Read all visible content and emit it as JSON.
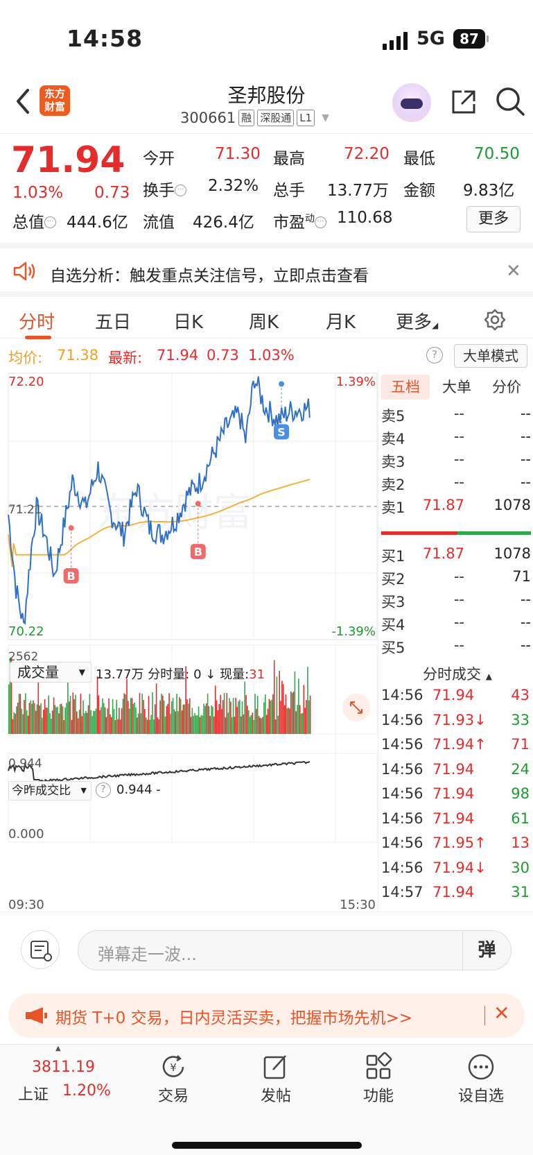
{
  "status_bar": {
    "time": "14:58",
    "network": "5G",
    "battery": "87"
  },
  "header": {
    "logo": "东方财富",
    "stock_name": "圣邦股份",
    "code": "300661",
    "tags": [
      "融",
      "深股通",
      "L1"
    ]
  },
  "quote": {
    "price": "71.94",
    "change_pct": "1.03%",
    "change": "0.73",
    "fields": [
      {
        "label": "今开",
        "value": "71.30",
        "color": "#e32d2d"
      },
      {
        "label": "最高",
        "value": "72.20",
        "color": "#e32d2d"
      },
      {
        "label": "最低",
        "value": "70.50",
        "color": "#1f9a33"
      },
      {
        "label": "换手",
        "value": "2.32%",
        "color": "#222"
      },
      {
        "label": "总手",
        "value": "13.77万",
        "color": "#222"
      },
      {
        "label": "金额",
        "value": "9.83亿",
        "color": "#222"
      },
      {
        "label": "总值",
        "value": "444.6亿",
        "color": "#222"
      },
      {
        "label": "流值",
        "value": "426.4亿",
        "color": "#222"
      },
      {
        "label": "市盈",
        "value": "110.68",
        "color": "#222",
        "sup": "动"
      }
    ],
    "more_label": "更多"
  },
  "alert": {
    "text": "自选分析：触发重点关注信号，立即点击查看"
  },
  "tabs": [
    {
      "label": "分时",
      "active": true
    },
    {
      "label": "五日"
    },
    {
      "label": "日K"
    },
    {
      "label": "周K"
    },
    {
      "label": "月K"
    },
    {
      "label": "更多"
    }
  ],
  "avg_bar": {
    "avg_label": "均价:",
    "avg_value": "71.38",
    "latest_label": "最新:",
    "latest_value": "71.94",
    "change": "0.73",
    "pct": "1.03%",
    "mode_button": "大单模式"
  },
  "chart_data": {
    "type": "line",
    "price_axis": {
      "top": "72.20",
      "mid": "71.21",
      "bottom": "70.22",
      "top_pct": "1.39%",
      "bottom_pct": "-1.39%"
    },
    "time_axis": {
      "start": "09:30",
      "end": "15:30"
    },
    "markers": [
      {
        "label": "B"
      },
      {
        "label": "B"
      },
      {
        "label": "S"
      }
    ],
    "volume": {
      "selector": "成交量",
      "total": "13.77万",
      "fenshi_label": "分时量:",
      "fenshi_value": "0",
      "arrow": "↓",
      "current_label": "现量:",
      "current_value": "31",
      "max": "2562"
    },
    "ratio": {
      "selector": "今昨成交比",
      "value": "0.944",
      "suffix": "-",
      "top": "0.944",
      "bottom": "0.000"
    }
  },
  "order_book": {
    "tabs": [
      "五档",
      "大单",
      "分价"
    ],
    "asks": [
      {
        "label": "卖5",
        "price": "--",
        "vol": "--"
      },
      {
        "label": "卖4",
        "price": "--",
        "vol": "--"
      },
      {
        "label": "卖3",
        "price": "--",
        "vol": "--"
      },
      {
        "label": "卖2",
        "price": "--",
        "vol": "--"
      },
      {
        "label": "卖1",
        "price": "71.87",
        "vol": "1078"
      }
    ],
    "bids": [
      {
        "label": "买1",
        "price": "71.87",
        "vol": "1078"
      },
      {
        "label": "买2",
        "price": "--",
        "vol": "71"
      },
      {
        "label": "买3",
        "price": "--",
        "vol": "--"
      },
      {
        "label": "买4",
        "price": "--",
        "vol": "--"
      },
      {
        "label": "买5",
        "price": "--",
        "vol": "--"
      }
    ]
  },
  "trades": {
    "title": "分时成交",
    "rows": [
      {
        "time": "14:56",
        "price": "71.94",
        "vol": "43",
        "vcolor": "#e32d2d",
        "arrow": ""
      },
      {
        "time": "14:56",
        "price": "71.93↓",
        "vol": "33",
        "vcolor": "#1f9a33",
        "arrow": "down"
      },
      {
        "time": "14:56",
        "price": "71.94↑",
        "vol": "71",
        "vcolor": "#e32d2d",
        "arrow": "up"
      },
      {
        "time": "14:56",
        "price": "71.94",
        "vol": "24",
        "vcolor": "#1f9a33",
        "arrow": ""
      },
      {
        "time": "14:56",
        "price": "71.94",
        "vol": "98",
        "vcolor": "#1f9a33",
        "arrow": ""
      },
      {
        "time": "14:56",
        "price": "71.94",
        "vol": "61",
        "vcolor": "#1f9a33",
        "arrow": ""
      },
      {
        "time": "14:56",
        "price": "71.95↑",
        "vol": "13",
        "vcolor": "#e32d2d",
        "arrow": "up"
      },
      {
        "time": "14:56",
        "price": "71.94↓",
        "vol": "30",
        "vcolor": "#1f9a33",
        "arrow": "down"
      },
      {
        "time": "14:57",
        "price": "71.94",
        "vol": "31",
        "vcolor": "#1f9a33",
        "arrow": ""
      }
    ]
  },
  "comment_bar": {
    "placeholder": "弹幕走一波...",
    "dan": "弹"
  },
  "promo": {
    "text": "期货 T+0 交易，日内灵活买卖，把握市场先机>>"
  },
  "nav": {
    "index_value": "3811.19",
    "index_name": "上证",
    "index_pct": "1.20%",
    "items": [
      {
        "label": "交易"
      },
      {
        "label": "发帖"
      },
      {
        "label": "功能"
      },
      {
        "label": "设自选"
      }
    ]
  }
}
